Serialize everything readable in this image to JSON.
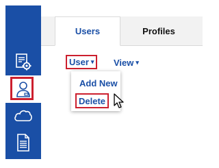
{
  "sidebar": {
    "items": [
      {
        "icon": "settings-document-icon",
        "active": false
      },
      {
        "icon": "user-profile-icon",
        "active": true
      },
      {
        "icon": "cloud-icon",
        "active": false
      },
      {
        "icon": "document-icon",
        "active": false
      }
    ]
  },
  "tabs": [
    {
      "label": "Users",
      "selected": true
    },
    {
      "label": "Profiles",
      "selected": false
    }
  ],
  "menu": {
    "user_label": "User",
    "view_label": "View",
    "caret": "▾"
  },
  "dropdown": {
    "items": [
      {
        "label": "Add New"
      },
      {
        "label": "Delete",
        "highlighted": true
      }
    ]
  },
  "colors": {
    "sidebar_blue": "#1a4fa6",
    "link_blue": "#1a4fa6",
    "highlight_red": "#cc1f2e",
    "tab_strip_gray": "#f2f2f2"
  }
}
